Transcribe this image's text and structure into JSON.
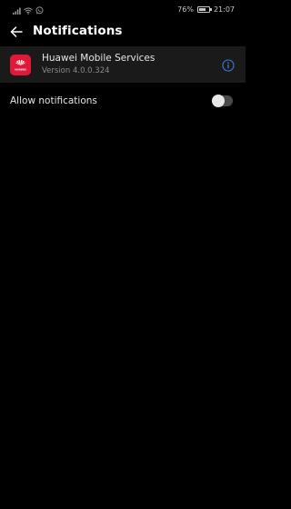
{
  "status_bar": {
    "battery_percent": "76%",
    "time": "21:07",
    "battery_level": 0.76
  },
  "header": {
    "title": "Notifications"
  },
  "app": {
    "name": "Huawei Mobile Services",
    "version": "Version 4.0.0.324",
    "icon_label": "HUAWEI",
    "icon_color": "#e0193a"
  },
  "settings": {
    "allow_notifications_label": "Allow notifications",
    "allow_notifications_enabled": false
  },
  "colors": {
    "background": "#000000",
    "card": "#1a1a1a",
    "accent_info": "#3b7dd8"
  }
}
